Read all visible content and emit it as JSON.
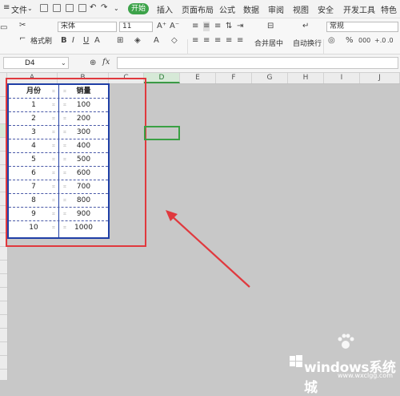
{
  "menu": {
    "file": "文件",
    "tabs": [
      "开始",
      "插入",
      "页面布局",
      "公式",
      "数据",
      "审阅",
      "视图",
      "安全",
      "开发工具",
      "特色"
    ]
  },
  "ribbon": {
    "format_painter": "格式刷",
    "font_name": "宋体",
    "font_size": "11",
    "merge_center": "合并居中",
    "wrap_text": "自动换行",
    "number_format": "常规",
    "percent": "%",
    "thousands": "000"
  },
  "formula_bar": {
    "cell_ref": "D4",
    "fx_label": "fx",
    "content": ""
  },
  "columns": [
    "A",
    "B",
    "C",
    "D",
    "E",
    "F",
    "G",
    "H",
    "I",
    "J"
  ],
  "table": {
    "headers": [
      "月份",
      "销量"
    ],
    "rows": [
      [
        "1",
        "100"
      ],
      [
        "2",
        "200"
      ],
      [
        "3",
        "300"
      ],
      [
        "4",
        "400"
      ],
      [
        "5",
        "500"
      ],
      [
        "6",
        "600"
      ],
      [
        "7",
        "700"
      ],
      [
        "8",
        "800"
      ],
      [
        "9",
        "900"
      ],
      [
        "10",
        "1000"
      ]
    ]
  },
  "watermark": {
    "main": "windows系统城",
    "sub": "www.wxclgg.com"
  },
  "colors": {
    "accent_green": "#3da34a",
    "annotation_red": "#e0393e",
    "table_border": "#1f3fa6"
  }
}
